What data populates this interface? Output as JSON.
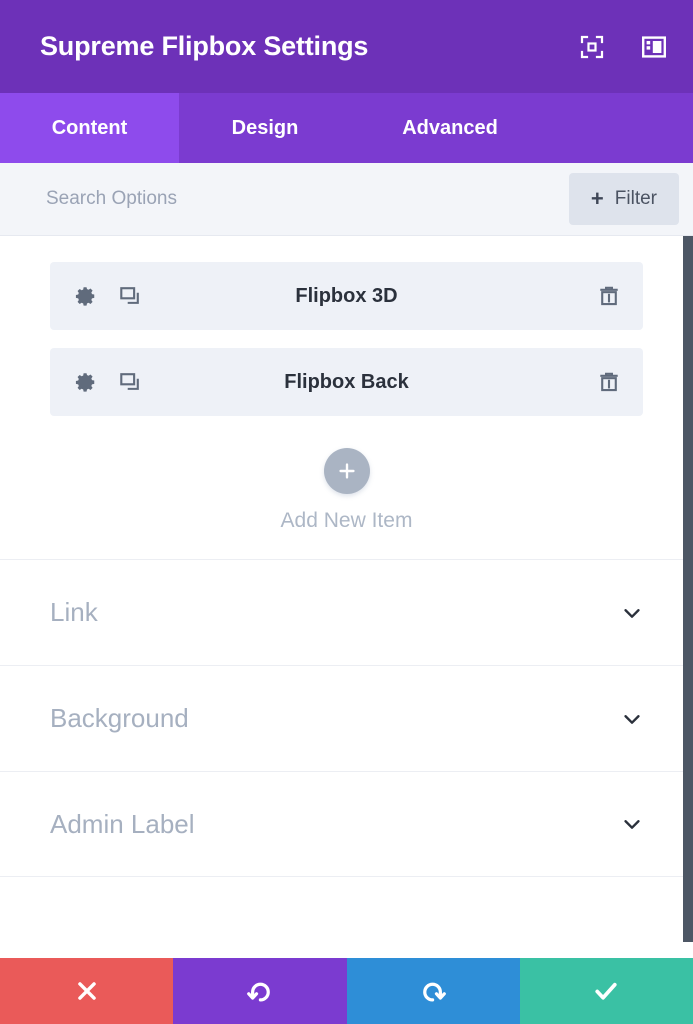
{
  "header": {
    "title": "Supreme Flipbox Settings",
    "icons": [
      {
        "name": "focus-mode-icon",
        "label": "Focus Mode"
      },
      {
        "name": "layout-panel-icon",
        "label": "Change Modal Position"
      }
    ]
  },
  "tabs": [
    {
      "label": "Content",
      "active": true
    },
    {
      "label": "Design",
      "active": false
    },
    {
      "label": "Advanced",
      "active": false
    }
  ],
  "search": {
    "placeholder": "Search Options",
    "value": "",
    "filter_label": "Filter",
    "filter_plus": "+"
  },
  "items": [
    {
      "title": "Flipbox 3D",
      "settings_label": "Settings",
      "duplicate_label": "Duplicate",
      "delete_label": "Delete"
    },
    {
      "title": "Flipbox Back",
      "settings_label": "Settings",
      "duplicate_label": "Duplicate",
      "delete_label": "Delete"
    }
  ],
  "add_new": {
    "label": "Add New Item",
    "icon": "plus-icon"
  },
  "toggles": [
    {
      "label": "Link",
      "expanded": false,
      "icon": "chevron-down-icon"
    },
    {
      "label": "Background",
      "expanded": false,
      "icon": "chevron-down-icon"
    },
    {
      "label": "Admin Label",
      "expanded": false,
      "icon": "chevron-down-icon"
    }
  ],
  "footer": [
    {
      "name": "cancel-button",
      "icon": "close-icon",
      "label": "Cancel",
      "color": "#ea5a59"
    },
    {
      "name": "undo-button",
      "icon": "undo-icon",
      "label": "Undo",
      "color": "#7b3bd0"
    },
    {
      "name": "redo-button",
      "icon": "redo-icon",
      "label": "Redo",
      "color": "#2e8ed7"
    },
    {
      "name": "save-button",
      "icon": "check-icon",
      "label": "Save Changes",
      "color": "#3ac1a4"
    }
  ],
  "colors": {
    "header_purple": "#6d31b8",
    "tabbar_purple": "#7b3bd0",
    "tab_active_purple": "#8e4bec",
    "search_bg": "#f3f5f9",
    "item_bg": "#eef1f7",
    "muted_text": "#a6b0c0",
    "scrollbar": "#4d5765"
  },
  "scrollbar": {
    "name": "vertical-scrollbar"
  }
}
